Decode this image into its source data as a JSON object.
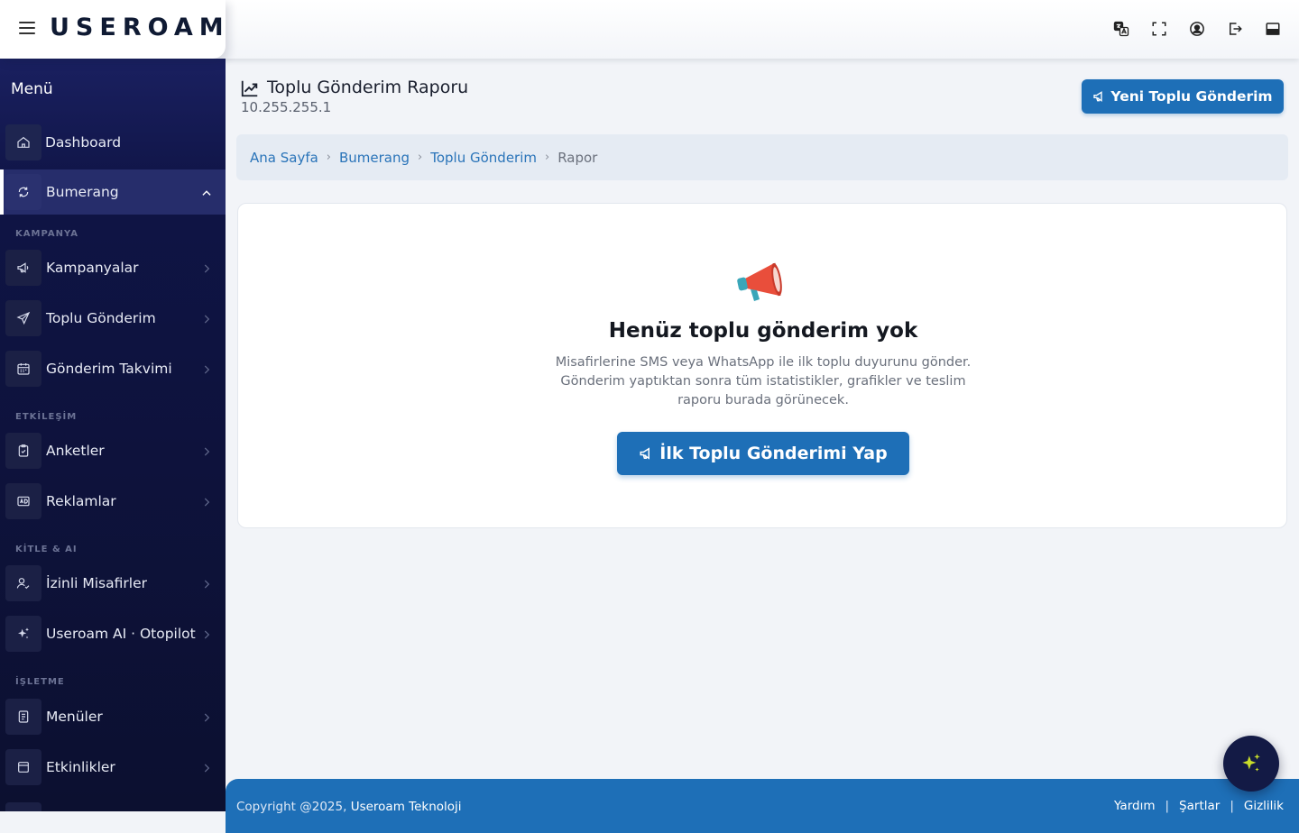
{
  "header": {
    "logo_text": "USEROAM",
    "icons": [
      "translate-icon",
      "fullscreen-icon",
      "user-icon",
      "logout-icon",
      "panel-icon"
    ]
  },
  "sidebar": {
    "title": "Menü",
    "items": [
      {
        "label": "Dashboard",
        "icon": "home-icon"
      },
      {
        "label": "Bumerang",
        "icon": "refresh-icon"
      },
      {
        "label": "Kampanyalar",
        "icon": "megaphone-icon"
      },
      {
        "label": "Toplu Gönderim",
        "icon": "send-icon"
      },
      {
        "label": "Gönderim Takvimi",
        "icon": "calendar-icon"
      },
      {
        "label": "Anketler",
        "icon": "clipboard-icon"
      },
      {
        "label": "Reklamlar",
        "icon": "ad-icon"
      },
      {
        "label": "İzinli Misafirler",
        "icon": "user-check-icon"
      },
      {
        "label": "Useroam AI · Otopilot",
        "icon": "sparkle-icon"
      },
      {
        "label": "Menüler",
        "icon": "menu-doc-icon"
      },
      {
        "label": "Etkinlikler",
        "icon": "event-icon"
      }
    ],
    "sections": [
      "KAMPANYA",
      "ETKİLEŞİM",
      "KİTLE & AI",
      "İŞLETME"
    ]
  },
  "page": {
    "title": "Toplu Gönderim Raporu",
    "subtitle": "10.255.255.1",
    "new_button": "Yeni Toplu Gönderim"
  },
  "breadcrumb": {
    "items": [
      "Ana Sayfa",
      "Bumerang",
      "Toplu Gönderim"
    ],
    "current": "Rapor"
  },
  "empty_state": {
    "title": "Henüz toplu gönderim yok",
    "description": "Misafirlerine SMS veya WhatsApp ile ilk toplu duyurunu gönder. Gönderim yaptıktan sonra tüm istatistikler, grafikler ve teslim raporu burada görünecek.",
    "button": "İlk Toplu Gönderimi Yap"
  },
  "footer": {
    "copyright": "Copyright @2025,",
    "company": "Useroam Teknoloji",
    "links": [
      "Yardım",
      "Şartlar",
      "Gizlilik"
    ],
    "separator": "|"
  },
  "colors": {
    "primary": "#1e6fb7",
    "sidebar_bg": "#0f1445",
    "accent": "#c8dc2a"
  }
}
